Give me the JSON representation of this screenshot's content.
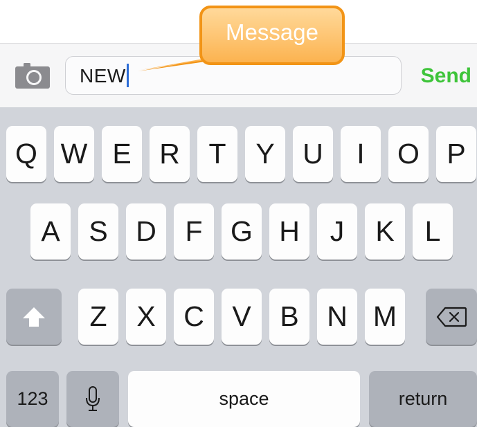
{
  "message_bar": {
    "camera_icon": "camera-icon",
    "input_value": "NEW",
    "send_label": "Send"
  },
  "callout": {
    "label": "Message"
  },
  "keyboard": {
    "row1": [
      "Q",
      "W",
      "E",
      "R",
      "T",
      "Y",
      "U",
      "I",
      "O",
      "P"
    ],
    "row2": [
      "A",
      "S",
      "D",
      "F",
      "G",
      "H",
      "J",
      "K",
      "L"
    ],
    "row3": [
      "Z",
      "X",
      "C",
      "V",
      "B",
      "N",
      "M"
    ],
    "shift_icon": "shift-arrow-icon",
    "delete_icon": "backspace-icon",
    "numbers_label": "123",
    "mic_icon": "microphone-icon",
    "space_label": "space",
    "return_label": "return"
  },
  "colors": {
    "send_green": "#3ec43a",
    "callout_orange": "#f29416",
    "caret_blue": "#2c6cd6",
    "keyboard_bg": "#d1d4da"
  }
}
